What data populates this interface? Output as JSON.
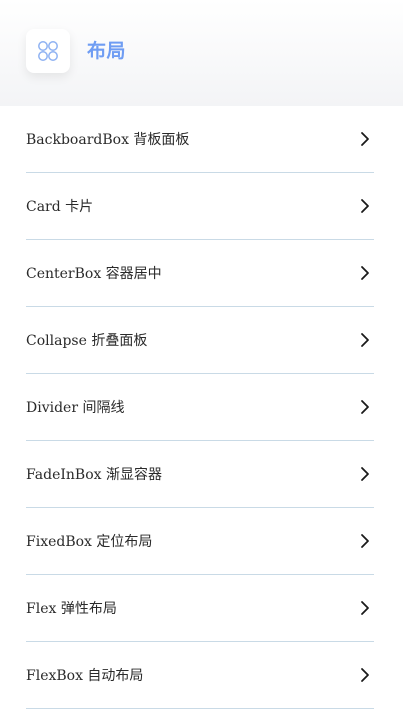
{
  "header": {
    "title": "布局",
    "icon": "grid-circles-icon",
    "accent_color": "#6f9df3"
  },
  "items": [
    {
      "label": "BackboardBox 背板面板"
    },
    {
      "label": "Card 卡片"
    },
    {
      "label": "CenterBox 容器居中"
    },
    {
      "label": "Collapse 折叠面板"
    },
    {
      "label": "Divider 间隔线"
    },
    {
      "label": "FadeInBox 渐显容器"
    },
    {
      "label": "FixedBox 定位布局"
    },
    {
      "label": "Flex 弹性布局"
    },
    {
      "label": "FlexBox 自动布局"
    }
  ],
  "chevron_icon": "chevron-right-icon",
  "divider_color": "#c9dae6"
}
